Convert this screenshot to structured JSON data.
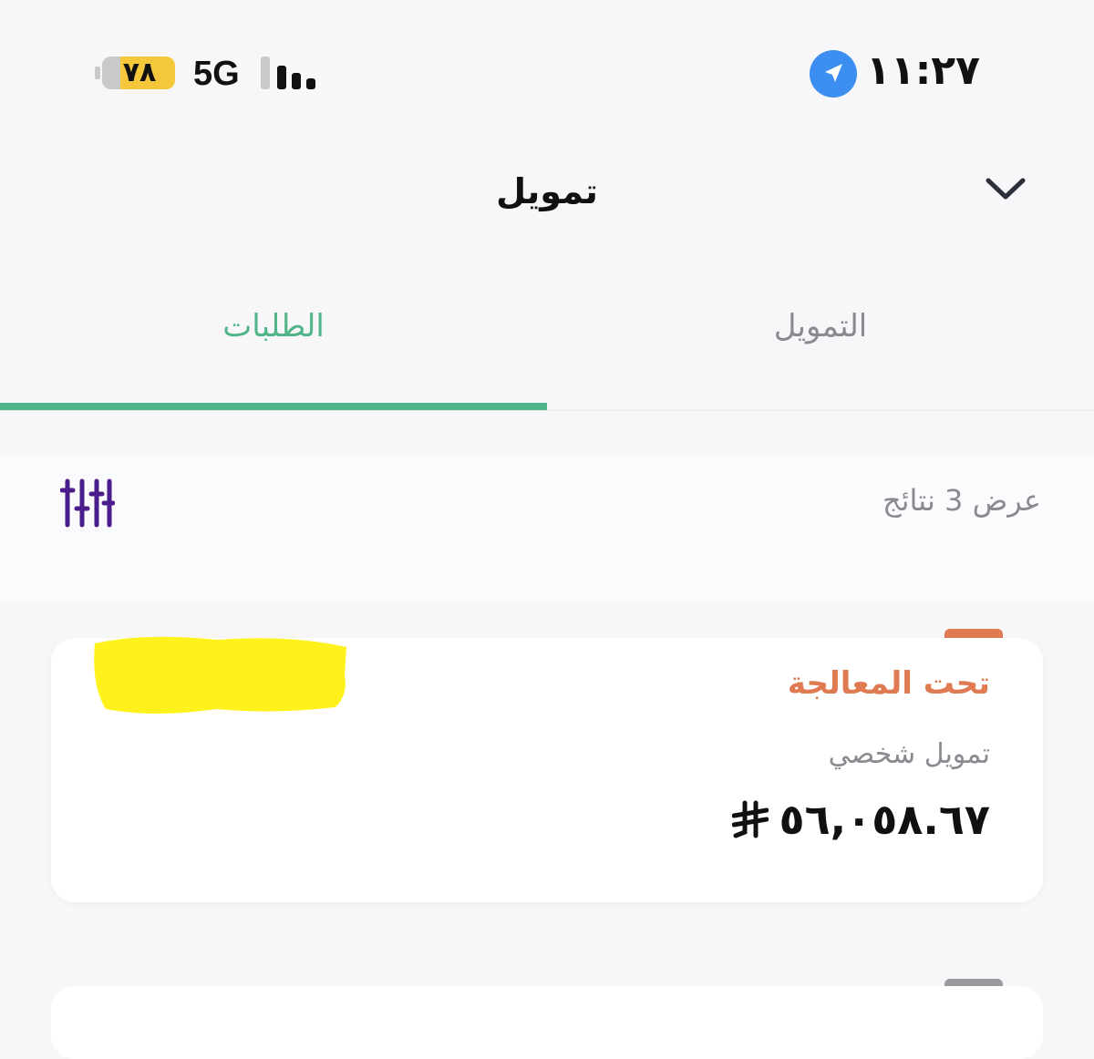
{
  "status_bar": {
    "time": "١١:٢٧",
    "battery": "٧٨",
    "network": "5G"
  },
  "header": {
    "title": "تمويل"
  },
  "tabs": [
    {
      "label": "الطلبات",
      "active": true
    },
    {
      "label": "التمويل",
      "active": false
    }
  ],
  "results": {
    "count_text": "عرض 3 نتائج"
  },
  "cards": [
    {
      "status": "تحت المعالجة",
      "type": "تمويل شخصي",
      "amount": "٥٦,٠٥٨.٦٧"
    }
  ],
  "colors": {
    "accent_green": "#52b58a",
    "status_orange": "#df7a52",
    "filter_purple": "#4b1c8c",
    "location_blue": "#3c8ef0",
    "battery_yellow": "#f4c83a"
  },
  "icons": {
    "location": "location-arrow-icon",
    "chevron": "chevron-down-icon",
    "filter": "sliders-filter-icon",
    "currency": "riyal-sign-icon"
  }
}
